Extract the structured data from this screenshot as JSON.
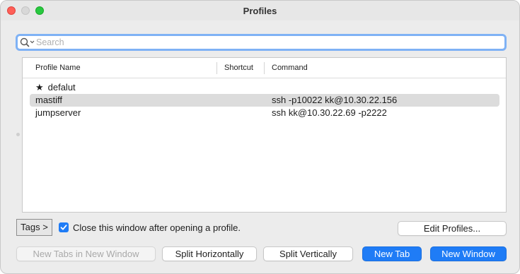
{
  "window": {
    "title": "Profiles"
  },
  "search": {
    "placeholder": "Search",
    "value": ""
  },
  "table": {
    "columns": [
      "Profile Name",
      "Shortcut",
      "Command"
    ],
    "rows": [
      {
        "name": "defalut",
        "default": true,
        "shortcut": "",
        "command": ""
      },
      {
        "name": "mastiff",
        "default": false,
        "shortcut": "",
        "command": "ssh -p10022 kk@10.30.22.156",
        "selected": true
      },
      {
        "name": "jumpserver",
        "default": false,
        "shortcut": "",
        "command": "ssh kk@10.30.22.69 -p2222"
      }
    ]
  },
  "footer": {
    "tags_label": "Tags >",
    "close_after_open_label": "Close this window after opening a profile.",
    "close_after_open_checked": true,
    "edit_profiles_label": "Edit Profiles...",
    "new_tabs_in_new_window_label": "New Tabs in New Window",
    "split_horizontally_label": "Split Horizontally",
    "split_vertically_label": "Split Vertically",
    "new_tab_label": "New Tab",
    "new_window_label": "New Window"
  },
  "colors": {
    "accent": "#1f7cf6",
    "selection": "#dcdcdc",
    "focus_ring": "#7fb2f5"
  },
  "icons": [
    "search-icon",
    "star-icon",
    "checkmark-icon"
  ]
}
